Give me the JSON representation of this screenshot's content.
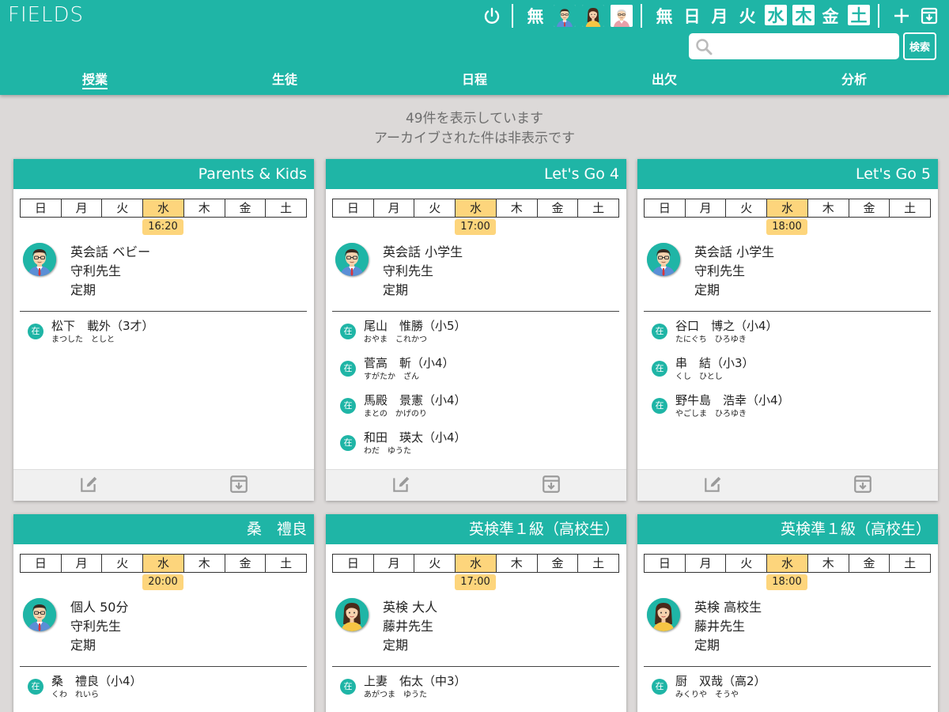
{
  "app": {
    "logo": "FIELDS"
  },
  "toolbar": {
    "filter_none_label": "無",
    "teacher_avatars": [
      "teacher-male",
      "teacher-female",
      "teacher-elder"
    ],
    "day_none_label": "無",
    "days": [
      {
        "label": "日",
        "selected": false
      },
      {
        "label": "月",
        "selected": false
      },
      {
        "label": "火",
        "selected": false
      },
      {
        "label": "水",
        "selected": true
      },
      {
        "label": "木",
        "selected": true
      },
      {
        "label": "金",
        "selected": false
      },
      {
        "label": "土",
        "selected": true
      }
    ]
  },
  "search": {
    "placeholder": "",
    "value": "",
    "button_label": "検索"
  },
  "nav": {
    "tabs": [
      {
        "label": "授業",
        "active": true
      },
      {
        "label": "生徒",
        "active": false
      },
      {
        "label": "日程",
        "active": false
      },
      {
        "label": "出欠",
        "active": false
      },
      {
        "label": "分析",
        "active": false
      }
    ]
  },
  "summary": {
    "line1": "49件を表示しています",
    "line2": "アーカイブされた件は非表示です"
  },
  "weekdays": [
    "日",
    "月",
    "火",
    "水",
    "木",
    "金",
    "土"
  ],
  "cards": [
    {
      "title": "Parents & Kids",
      "active_day": 3,
      "time": "16:20",
      "teacher_avatar": "teacher-male",
      "course": "英会話 ベビー",
      "teacher": "守利先生",
      "type": "定期",
      "students": [
        {
          "status": "在",
          "name": "松下　載外（3才）",
          "kana": "まつした　としと"
        }
      ]
    },
    {
      "title": "Let's Go 4",
      "active_day": 3,
      "time": "17:00",
      "teacher_avatar": "teacher-male",
      "course": "英会話 小学生",
      "teacher": "守利先生",
      "type": "定期",
      "students": [
        {
          "status": "在",
          "name": "尾山　惟勝（小5）",
          "kana": "おやま　これかつ"
        },
        {
          "status": "在",
          "name": "菅高　斬（小4）",
          "kana": "すがたか　ざん"
        },
        {
          "status": "在",
          "name": "馬殿　景憲（小4）",
          "kana": "まとの　かげのり"
        },
        {
          "status": "在",
          "name": "和田　瑛太（小4）",
          "kana": "わだ　ゆうた"
        }
      ]
    },
    {
      "title": "Let's Go 5",
      "active_day": 3,
      "time": "18:00",
      "teacher_avatar": "teacher-male",
      "course": "英会話 小学生",
      "teacher": "守利先生",
      "type": "定期",
      "students": [
        {
          "status": "在",
          "name": "谷口　博之（小4）",
          "kana": "たにぐち　ひろゆき"
        },
        {
          "status": "在",
          "name": "串　結（小3）",
          "kana": "くし　ひとし"
        },
        {
          "status": "在",
          "name": "野牛島　浩幸（小4）",
          "kana": "やごしま　ひろゆき"
        }
      ]
    },
    {
      "title": "桑　禮良",
      "active_day": 3,
      "time": "20:00",
      "teacher_avatar": "teacher-male",
      "course": "個人 50分",
      "teacher": "守利先生",
      "type": "定期",
      "students": [
        {
          "status": "在",
          "name": "桑　禮良（小4）",
          "kana": "くわ　れいら"
        }
      ]
    },
    {
      "title": "英検準１級（高校生）",
      "active_day": 3,
      "time": "17:00",
      "teacher_avatar": "teacher-female",
      "course": "英検 大人",
      "teacher": "藤井先生",
      "type": "定期",
      "students": [
        {
          "status": "在",
          "name": "上妻　佑太（中3）",
          "kana": "あがつま　ゆうた"
        }
      ]
    },
    {
      "title": "英検準１級（高校生）",
      "active_day": 3,
      "time": "18:00",
      "teacher_avatar": "teacher-female",
      "course": "英検 高校生",
      "teacher": "藤井先生",
      "type": "定期",
      "students": [
        {
          "status": "在",
          "name": "厨　双哉（高2）",
          "kana": "みくりや　そうや"
        }
      ]
    }
  ],
  "colors": {
    "accent": "#1fb5a6",
    "highlight": "#fdd57c",
    "background": "#dcd9d8"
  }
}
